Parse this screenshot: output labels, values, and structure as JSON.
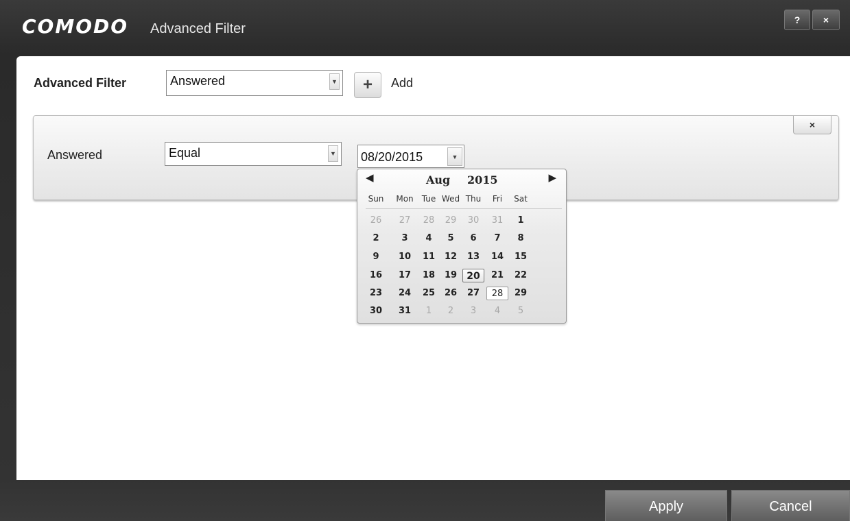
{
  "window": {
    "brand": "COMODO",
    "title": "Advanced Filter",
    "help_label": "?",
    "close_label": "×"
  },
  "filter_bar": {
    "label": "Advanced Filter",
    "selected": "Answered",
    "dropdown_icon": "chevron-down-icon",
    "add_icon": "plus-icon",
    "add_label": "Add"
  },
  "condition": {
    "close_label": "×",
    "field_label": "Answered",
    "operator": "Equal",
    "date_value": "08/20/2015"
  },
  "calendar": {
    "prev_glyph": "◀",
    "next_glyph": "▶",
    "month": "Aug",
    "year": "2015",
    "weekdays": [
      "Sun",
      "Mon",
      "Tue",
      "Wed",
      "Thu",
      "Fri",
      "Sat"
    ],
    "selected_day": "20",
    "today_day": "28",
    "weeks": [
      [
        {
          "d": "26",
          "o": true
        },
        {
          "d": "27",
          "o": true
        },
        {
          "d": "28",
          "o": true
        },
        {
          "d": "29",
          "o": true
        },
        {
          "d": "30",
          "o": true
        },
        {
          "d": "31",
          "o": true
        },
        {
          "d": "1",
          "o": false
        }
      ],
      [
        {
          "d": "2",
          "o": false
        },
        {
          "d": "3",
          "o": false
        },
        {
          "d": "4",
          "o": false
        },
        {
          "d": "5",
          "o": false
        },
        {
          "d": "6",
          "o": false
        },
        {
          "d": "7",
          "o": false
        },
        {
          "d": "8",
          "o": false
        }
      ],
      [
        {
          "d": "9",
          "o": false
        },
        {
          "d": "10",
          "o": false
        },
        {
          "d": "11",
          "o": false
        },
        {
          "d": "12",
          "o": false
        },
        {
          "d": "13",
          "o": false
        },
        {
          "d": "14",
          "o": false
        },
        {
          "d": "15",
          "o": false
        }
      ],
      [
        {
          "d": "16",
          "o": false
        },
        {
          "d": "17",
          "o": false
        },
        {
          "d": "18",
          "o": false
        },
        {
          "d": "19",
          "o": false
        },
        {
          "d": "20",
          "o": false
        },
        {
          "d": "21",
          "o": false
        },
        {
          "d": "22",
          "o": false
        }
      ],
      [
        {
          "d": "23",
          "o": false
        },
        {
          "d": "24",
          "o": false
        },
        {
          "d": "25",
          "o": false
        },
        {
          "d": "26",
          "o": false
        },
        {
          "d": "27",
          "o": false
        },
        {
          "d": "28",
          "o": false
        },
        {
          "d": "29",
          "o": false
        }
      ],
      [
        {
          "d": "30",
          "o": false
        },
        {
          "d": "31",
          "o": false
        },
        {
          "d": "1",
          "o": true
        },
        {
          "d": "2",
          "o": true
        },
        {
          "d": "3",
          "o": true
        },
        {
          "d": "4",
          "o": true
        },
        {
          "d": "5",
          "o": true
        }
      ]
    ]
  },
  "footer": {
    "apply_label": "Apply",
    "cancel_label": "Cancel"
  }
}
